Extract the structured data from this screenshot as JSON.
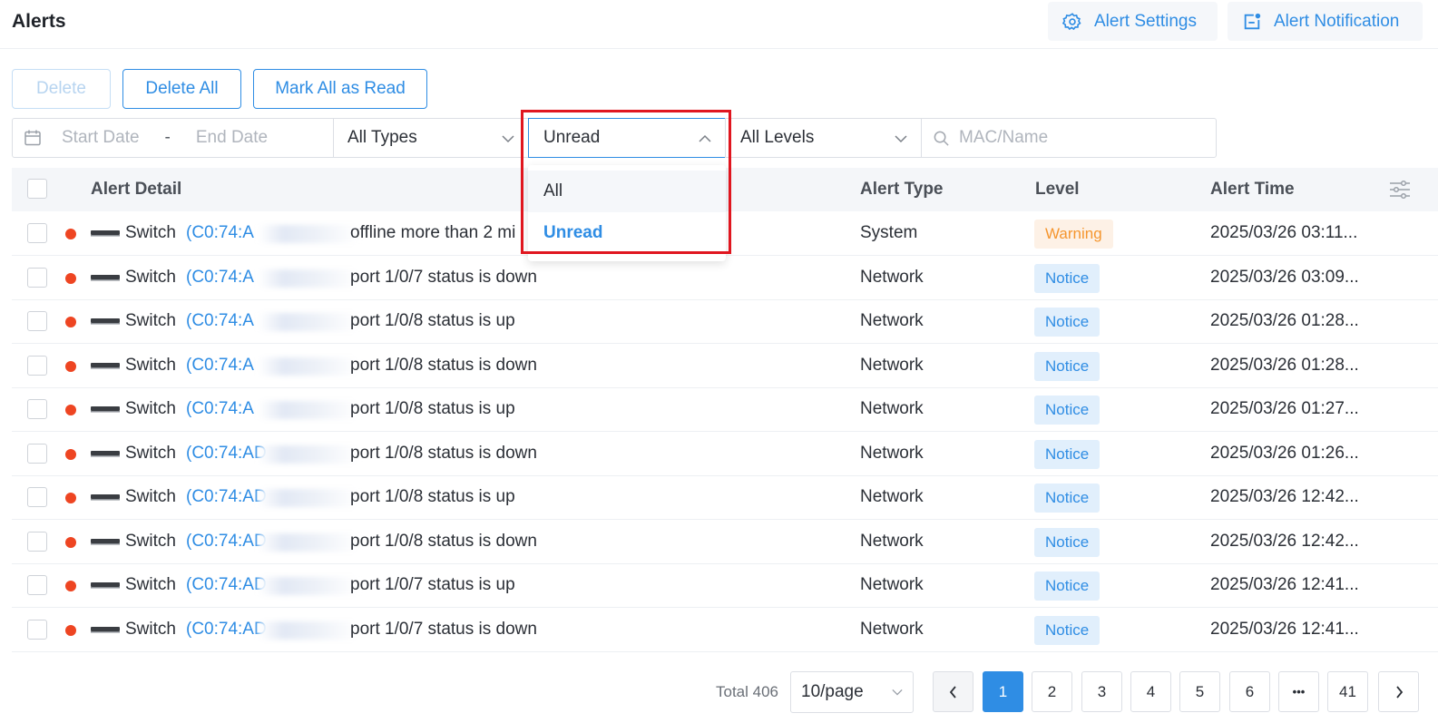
{
  "header": {
    "title": "Alerts",
    "alert_settings": "Alert Settings",
    "alert_notification": "Alert Notification"
  },
  "actions": {
    "delete": "Delete",
    "delete_all": "Delete All",
    "mark_all_read": "Mark All as Read"
  },
  "filters": {
    "start_date_placeholder": "Start Date",
    "date_separator": "-",
    "end_date_placeholder": "End Date",
    "types_value": "All Types",
    "read_value": "Unread",
    "levels_value": "All Levels",
    "search_placeholder": "MAC/Name"
  },
  "read_dropdown": {
    "options": [
      "All",
      "Unread"
    ],
    "selected": "Unread"
  },
  "table": {
    "columns": [
      "Alert Detail",
      "Alert Type",
      "Level",
      "Alert Time"
    ],
    "rows": [
      {
        "device": "Switch",
        "mac": "(C0:74:A",
        "message": "offline more than 2 mi",
        "type": "System",
        "level": "Warning",
        "time": "2025/03/26 03:11..."
      },
      {
        "device": "Switch",
        "mac": "(C0:74:A",
        "message": "port 1/0/7 status is down",
        "type": "Network",
        "level": "Notice",
        "time": "2025/03/26 03:09..."
      },
      {
        "device": "Switch",
        "mac": "(C0:74:A",
        "message": "port 1/0/8 status is up",
        "type": "Network",
        "level": "Notice",
        "time": "2025/03/26 01:28..."
      },
      {
        "device": "Switch",
        "mac": "(C0:74:A",
        "message": "port 1/0/8 status is down",
        "type": "Network",
        "level": "Notice",
        "time": "2025/03/26 01:28..."
      },
      {
        "device": "Switch",
        "mac": "(C0:74:A",
        "message": "port 1/0/8 status is up",
        "type": "Network",
        "level": "Notice",
        "time": "2025/03/26 01:27..."
      },
      {
        "device": "Switch",
        "mac": "(C0:74:AD",
        "message": "port 1/0/8 status is down",
        "type": "Network",
        "level": "Notice",
        "time": "2025/03/26 01:26..."
      },
      {
        "device": "Switch",
        "mac": "(C0:74:AD",
        "message": "port 1/0/8 status is up",
        "type": "Network",
        "level": "Notice",
        "time": "2025/03/26 12:42..."
      },
      {
        "device": "Switch",
        "mac": "(C0:74:AD",
        "message": "port 1/0/8 status is down",
        "type": "Network",
        "level": "Notice",
        "time": "2025/03/26 12:42..."
      },
      {
        "device": "Switch",
        "mac": "(C0:74:AD",
        "message": "port 1/0/7 status is up",
        "type": "Network",
        "level": "Notice",
        "time": "2025/03/26 12:41..."
      },
      {
        "device": "Switch",
        "mac": "(C0:74:AD",
        "message": "port 1/0/7 status is down",
        "type": "Network",
        "level": "Notice",
        "time": "2025/03/26 12:41..."
      }
    ]
  },
  "pagination": {
    "total": "Total 406",
    "page_size": "10/page",
    "pages": [
      "1",
      "2",
      "3",
      "4",
      "5",
      "6"
    ],
    "ellipsis": "•••",
    "last": "41",
    "current": "1"
  },
  "colors": {
    "accent": "#2f8de4",
    "unread_dot": "#ee4522",
    "highlight": "#e0161f",
    "warning": "#f5962f"
  },
  "icons": [
    "gear-icon",
    "notification-icon",
    "calendar-icon",
    "chevron-down-icon",
    "chevron-up-icon",
    "search-icon",
    "column-settings-icon",
    "switch-device-icon",
    "chevron-left-icon",
    "chevron-right-icon"
  ]
}
